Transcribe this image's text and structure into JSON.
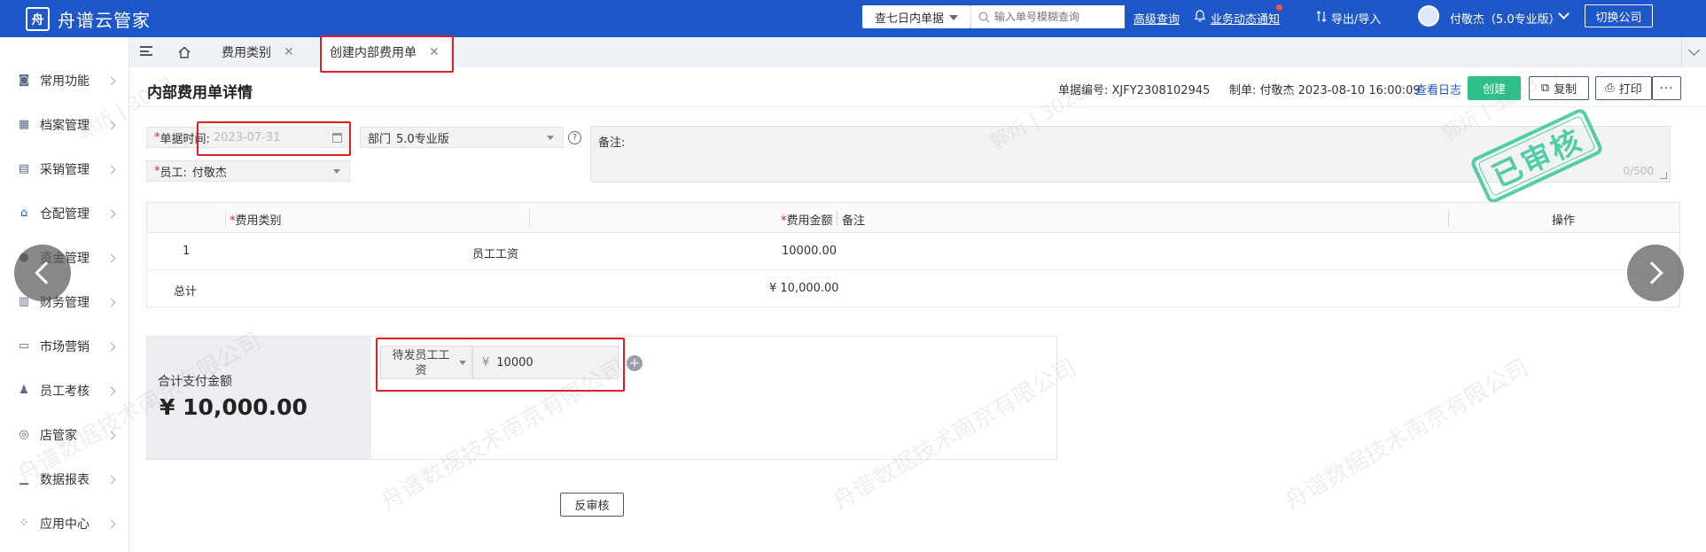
{
  "app": {
    "name": "舟谱云管家",
    "logo_glyph": "舟"
  },
  "topbar": {
    "filter_select": "查七日内单据",
    "search_placeholder": "输入单号模糊查询",
    "advanced_search": "高级查询",
    "notifications": "业务动态通知",
    "import_export": "导出/导入",
    "user": "付敬杰（5.0专业版）",
    "switch_company": "切换公司"
  },
  "sidebar": {
    "items": [
      {
        "label": "常用功能",
        "icon": "star-icon"
      },
      {
        "label": "档案管理",
        "icon": "archive-icon"
      },
      {
        "label": "采销管理",
        "icon": "purchase-icon"
      },
      {
        "label": "仓配管理",
        "icon": "warehouse-icon"
      },
      {
        "label": "资金管理",
        "icon": "fund-icon"
      },
      {
        "label": "财务管理",
        "icon": "finance-icon"
      },
      {
        "label": "市场营销",
        "icon": "store-icon"
      },
      {
        "label": "员工考核",
        "icon": "staff-icon"
      },
      {
        "label": "店管家",
        "icon": "shop-icon"
      },
      {
        "label": "数据报表",
        "icon": "chart-icon"
      },
      {
        "label": "应用中心",
        "icon": "apps-icon"
      }
    ]
  },
  "tabs": [
    {
      "label": "费用类别"
    },
    {
      "label": "创建内部费用单"
    }
  ],
  "page": {
    "title": "内部费用单详情",
    "doc_no": "单据编号: XJFY2308102945",
    "maker": "制单: 付敬杰 2023-08-10 16:00:09",
    "view_log": "查看日志",
    "create": "创建",
    "copy": "复制",
    "print": "打印",
    "more": "···"
  },
  "form": {
    "date_label": "单据时间:",
    "date_value": "2023-07-31",
    "dept_label": "部门",
    "dept_value": "5.0专业版",
    "employee_label": "员工:",
    "employee_value": "付敬杰",
    "remark_label": "备注:",
    "remark_count": "0/500",
    "help": "?"
  },
  "stamp": "已审核",
  "table": {
    "headers": {
      "category": "费用类别",
      "amount": "费用金额",
      "remark": "备注",
      "action": "操作"
    },
    "rows": [
      {
        "index": "1",
        "category": "员工工资",
        "amount": "10000.00",
        "remark": ""
      }
    ],
    "total_label": "总计",
    "total_value": "¥ 10,000.00"
  },
  "payment": {
    "label": "合计支付金额",
    "total": "¥ 10,000.00",
    "type": "待发员工工资",
    "currency": "¥",
    "amount": "10000",
    "add": "+"
  },
  "reverse_audit": "反审核",
  "watermark": "舟谱数据技术南京有限公司",
  "watermark_short": "郭炘 | 3023",
  "colors": {
    "brand": "#1d57c8",
    "success": "#2dbf87",
    "highlight": "#e02020",
    "stamp": "#34c79a"
  }
}
